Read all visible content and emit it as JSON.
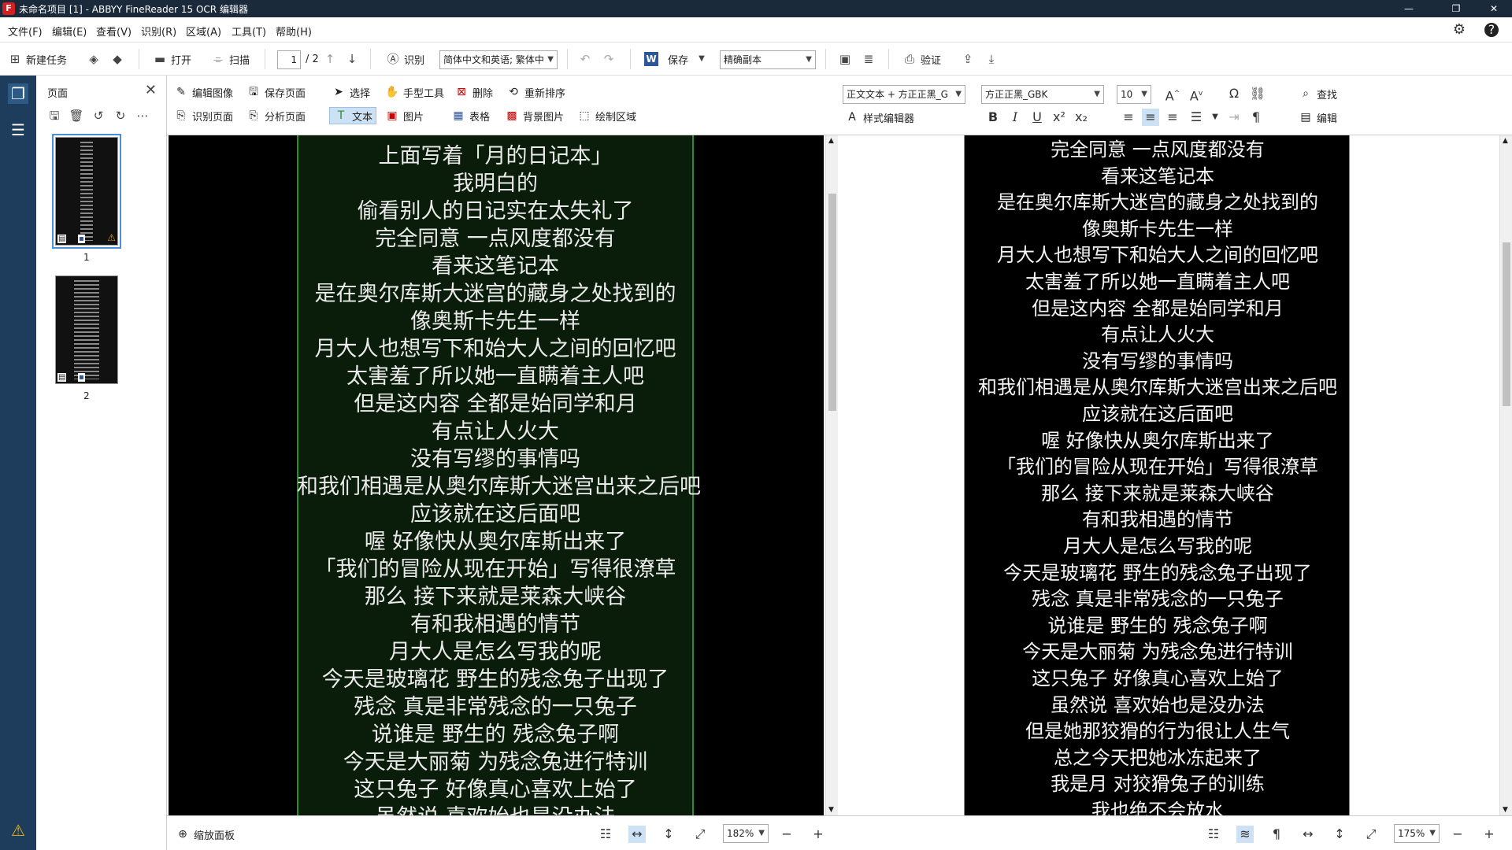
{
  "app": {
    "title": "未命名项目 [1] - ABBYY FineReader 15 OCR 编辑器",
    "logo_text": "F"
  },
  "menu": [
    "文件(F)",
    "编辑(E)",
    "查看(V)",
    "识别(R)",
    "区域(A)",
    "工具(T)",
    "帮助(H)"
  ],
  "toolbar": {
    "new_task": "新建任务",
    "open": "打开",
    "scan": "扫描",
    "page_current": "1",
    "page_total": "/ 2",
    "recognize": "识别",
    "language": "简体中文和英语; 繁体中",
    "save": "保存",
    "save_mode": "精确副本",
    "verify": "验证"
  },
  "pages_panel": {
    "header": "页面",
    "thumbs": [
      {
        "label": "1",
        "selected": true,
        "warning": true
      },
      {
        "label": "2",
        "selected": false,
        "warning": false
      }
    ]
  },
  "image_tools": {
    "edit_image": "编辑图像",
    "save_page": "保存页面",
    "recognize_page": "识别页面",
    "analyze_page": "分析页面",
    "select": "选择",
    "hand_tool": "手型工具",
    "delete": "删除",
    "reorder": "重新排序",
    "text": "文本",
    "picture": "图片",
    "table": "表格",
    "background_picture": "背景图片",
    "draw_area": "绘制区域"
  },
  "text_tools": {
    "style": "正文文本 + 方正正黑_G",
    "font": "方正正黑_GBK",
    "size": "10",
    "style_editor": "样式编辑器",
    "find": "查找",
    "edit": "编辑"
  },
  "image_lines": [
    "上面写着「月的日记本」",
    "我明白的",
    "偷看别人的日记实在太失礼了",
    "完全同意 一点风度都没有",
    "看来这笔记本",
    "是在奥尔库斯大迷宫的藏身之处找到的",
    "像奥斯卡先生一样",
    "月大人也想写下和始大人之间的回忆吧",
    "太害羞了所以她一直瞒着主人吧",
    "但是这内容 全都是始同学和月",
    "有点让人火大",
    "没有写缪的事情吗",
    "和我们相遇是从奥尔库斯大迷宫出来之后吧",
    "应该就在这后面吧",
    "喔 好像快从奥尔库斯出来了",
    "「我们的冒险从现在开始」写得很潦草",
    "那么 接下来就是莱森大峡谷",
    "有和我相遇的情节",
    "月大人是怎么写我的呢",
    "今天是玻璃花 野生的残念兔子出现了",
    "残念 真是非常残念的一只兔子",
    "说谁是 野生的 残念兔子啊",
    "今天是大丽菊 为残念兔进行特训",
    "这只兔子 好像真心喜欢上始了",
    "虽然说 喜欢始也是没办法"
  ],
  "text_lines": [
    "完全同意 一点风度都没有",
    "看来这笔记本",
    "是在奥尔库斯大迷宫的藏身之处找到的",
    "像奥斯卡先生一样",
    "月大人也想写下和始大人之间的回忆吧",
    "太害羞了所以她一直瞒着主人吧",
    "但是这内容 全都是始同学和月",
    "有点让人火大",
    "没有写缪的事情吗",
    "和我们相遇是从奥尔库斯大迷宫出来之后吧",
    "应该就在这后面吧",
    "喔 好像快从奥尔库斯出来了",
    "「我们的冒险从现在开始」写得很潦草",
    "那么 接下来就是莱森大峡谷",
    "有和我相遇的情节",
    "月大人是怎么写我的呢",
    "今天是玻璃花 野生的残念兔子出现了",
    "残念 真是非常残念的一只兔子",
    "说谁是 野生的 残念兔子啊",
    "今天是大丽菊 为残念兔进行特训",
    "这只兔子 好像真心喜欢上始了",
    "虽然说 喜欢始也是没办法",
    "但是她那狡猾的行为很让人生气",
    "总之今天把她冰冻起来了",
    "我是月 对狡猾兔子的训练",
    "我也绝不会放水"
  ],
  "bottom": {
    "zoom_panel": "缩放面板",
    "image_zoom": "182%",
    "text_zoom": "175%"
  },
  "colors": {
    "title_bg": "#1b2a3a",
    "rail_bg": "#1e3d5c",
    "block_border": "#2d8c2d",
    "accent": "#4a90d9"
  }
}
